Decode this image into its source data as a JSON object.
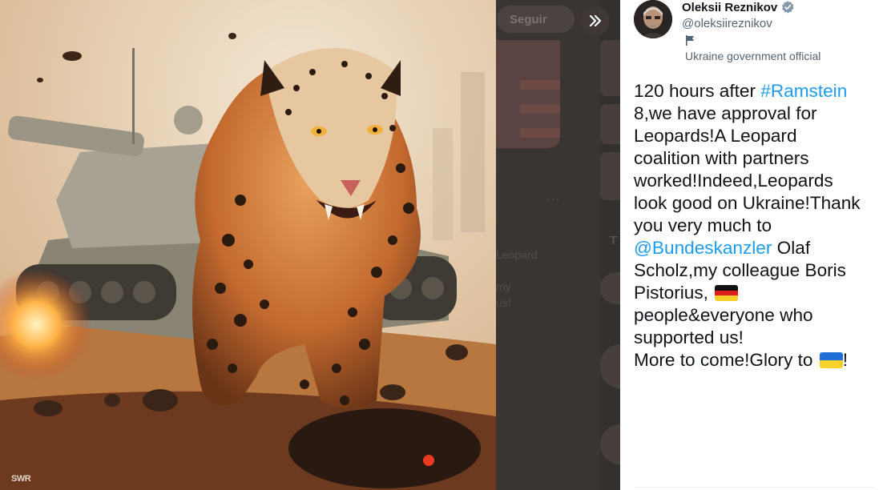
{
  "media": {
    "watermark": "SWR"
  },
  "background": {
    "follow_label": "Seguir",
    "more_dots": "···",
    "snippet_lines": [
      "Leopard",
      "my",
      "us!"
    ],
    "side_letter": "T"
  },
  "tweet": {
    "author_name": "Oleksii Reznikov",
    "author_handle": "@oleksiireznikov",
    "author_label": "Ukraine government official",
    "lines": {
      "l1_prefix": "120 hours after ",
      "l1_link": "#Ramstein",
      "l2": "8,we have approval for",
      "l3": "Leopards!A Leopard",
      "l4": "coalition with partners",
      "l5": "worked!Indeed,Leopards",
      "l6": "look good on Ukraine!Thank",
      "l7": "you very much to",
      "l8_link": "@Bundeskanzler",
      "l8_suffix": " Olaf",
      "l9": "Scholz,my colleague Boris",
      "l10": "Pistorius,",
      "l11": "people&everyone who",
      "l12": "supported us!",
      "l13_prefix": "More to come!Glory to ",
      "l13_suffix": "!"
    }
  },
  "colors": {
    "link": "#1d9bf0",
    "verified": "#829aab",
    "text": "#0f1419",
    "muted": "#536471"
  },
  "icons": [
    "expand-icon",
    "verified-badge-icon",
    "government-flag-icon",
    "germany-flag-emoji",
    "ukraine-flag-emoji"
  ]
}
